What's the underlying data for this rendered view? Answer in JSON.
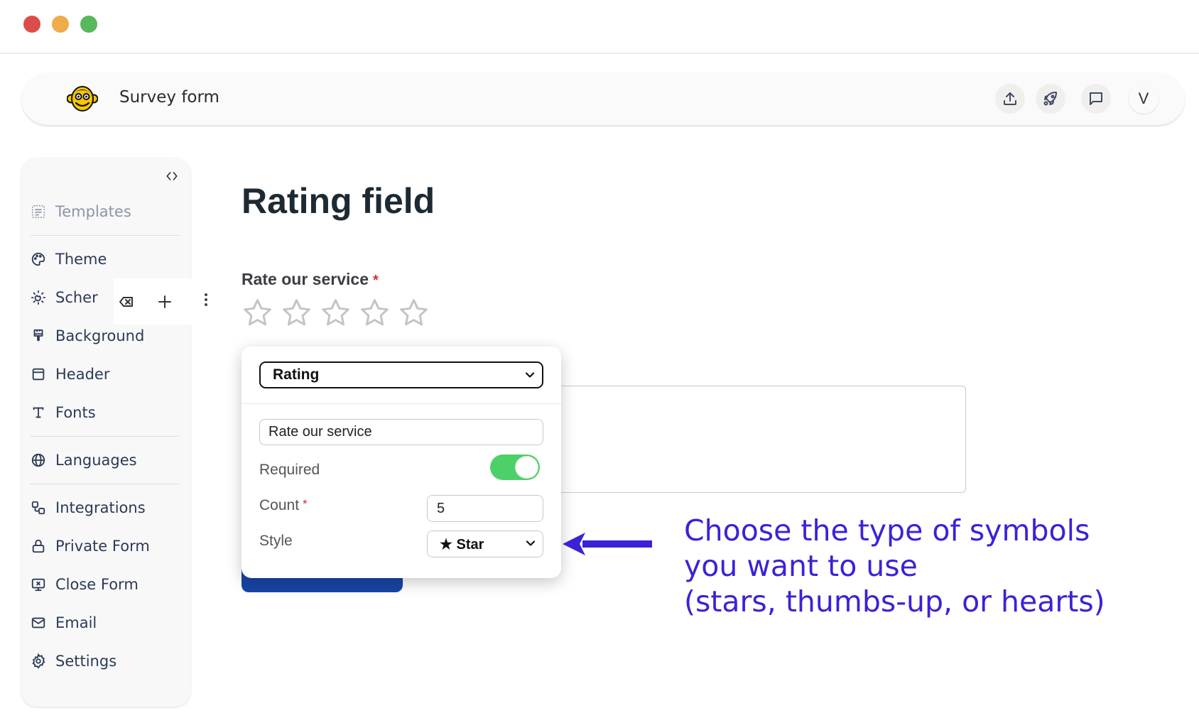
{
  "window": {
    "controls": [
      "close",
      "minimize",
      "maximize"
    ]
  },
  "header": {
    "logo_icon": "monkey-logo-icon",
    "title": "Survey form",
    "actions": [
      {
        "name": "upload-button",
        "icon": "upload-icon"
      },
      {
        "name": "publish-button",
        "icon": "rocket-icon"
      },
      {
        "name": "feedback-button",
        "icon": "chat-icon"
      }
    ],
    "avatar_initial": "V"
  },
  "sidebar": {
    "collapse_icon": "code-brackets-icon",
    "items": [
      {
        "label": "Templates",
        "icon": "templates-icon",
        "muted": true
      },
      {
        "label": "Theme",
        "icon": "palette-icon"
      },
      {
        "label": "Scher",
        "icon": "sun-moon-icon"
      },
      {
        "label": "Background",
        "icon": "paint-brush-icon"
      },
      {
        "label": "Header",
        "icon": "header-layout-icon"
      },
      {
        "label": "Fonts",
        "icon": "type-icon"
      },
      {
        "label": "Languages",
        "icon": "globe-icon"
      },
      {
        "label": "Integrations",
        "icon": "integrations-icon"
      },
      {
        "label": "Private Form",
        "icon": "lock-icon"
      },
      {
        "label": "Close Form",
        "icon": "screen-x-icon"
      },
      {
        "label": "Email",
        "icon": "mail-icon"
      },
      {
        "label": "Settings",
        "icon": "gear-icon"
      }
    ]
  },
  "field_toolbar": {
    "delete_icon": "backspace-icon",
    "add_icon": "plus-icon",
    "more_icon": "kebab-icon"
  },
  "main": {
    "title": "Rating field",
    "question": {
      "label": "Rate our service",
      "required_mark": "*",
      "star_count": 5,
      "selected": 0
    }
  },
  "popup": {
    "field_type": "Rating",
    "label_value": "Rate our service",
    "required_label": "Required",
    "required_on": true,
    "count_label": "Count",
    "count_required_mark": "*",
    "count_value": "5",
    "style_label": "Style",
    "style_value": "★ Star"
  },
  "annotation": {
    "text": "Choose the type of symbols\nyou want to use\n(stars, thumbs-up, or hearts)",
    "color": "#3a22d8"
  },
  "colors": {
    "toggle_on": "#4cd168",
    "submit_button": "#1745a5",
    "required_star": "#d0312d"
  }
}
